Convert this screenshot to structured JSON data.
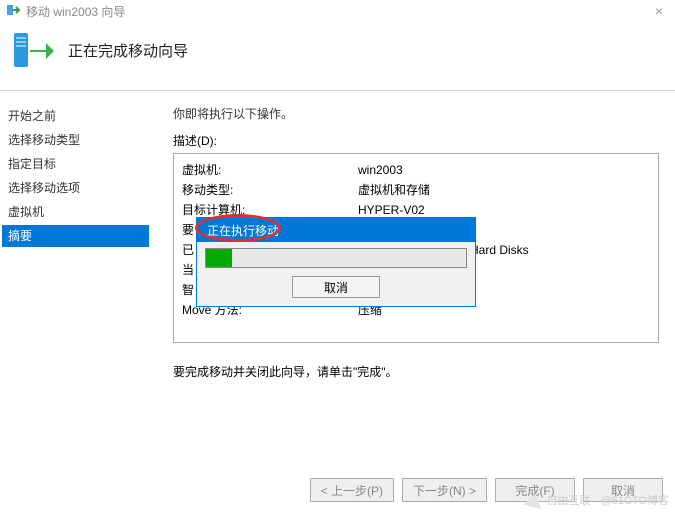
{
  "window": {
    "title": "移动 win2003 向导"
  },
  "header": {
    "title": "正在完成移动向导"
  },
  "sidebar": {
    "items": [
      {
        "label": "开始之前"
      },
      {
        "label": "选择移动类型"
      },
      {
        "label": "指定目标"
      },
      {
        "label": "选择移动选项"
      },
      {
        "label": "虚拟机"
      },
      {
        "label": "摘要"
      }
    ]
  },
  "main": {
    "intro": "你即将执行以下操作。",
    "desc_label": "描述(D):",
    "rows": {
      "vm_label": "虚拟机:",
      "vm_value": "win2003",
      "type_label": "移动类型:",
      "type_value": "虚拟机和存储",
      "target_label": "目标计算机:",
      "target_value": "HYPER-V02",
      "item_label_partial": "要",
      "move_label_partial": "已",
      "current_label_partial": "当",
      "smart_label_partial": "智",
      "hard_disks_value": "Hard Disks",
      "method_label": "Move 方法:",
      "method_value": "压缩"
    },
    "footer_text": "要完成移动并关闭此向导，请单击\"完成\"。"
  },
  "progress": {
    "title": "正在执行移动",
    "percent": 10,
    "cancel_label": "取消"
  },
  "buttons": {
    "prev": "< 上一步(P)",
    "next": "下一步(N) >",
    "finish": "完成(F)",
    "cancel": "取消"
  },
  "watermark": {
    "text1": "自由互联",
    "text2": "@51CTO博客"
  }
}
